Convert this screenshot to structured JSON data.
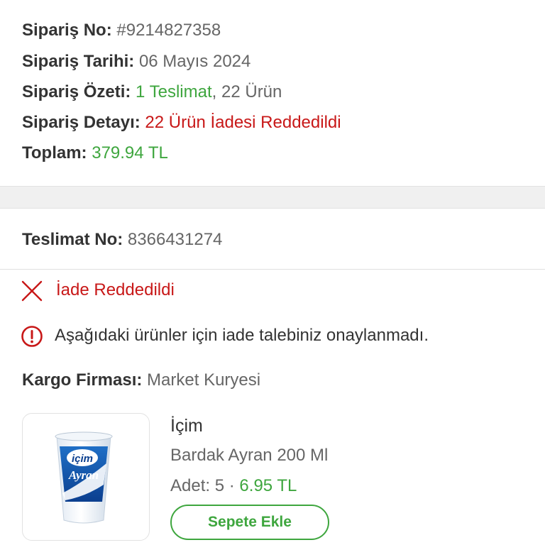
{
  "order": {
    "no_label": "Sipariş No:",
    "no_value": "#9214827358",
    "date_label": "Sipariş Tarihi:",
    "date_value": "06 Mayıs 2024",
    "summary_label": "Sipariş Özeti:",
    "summary_delivery": "1 Teslimat",
    "summary_sep": ",",
    "summary_items": " 22 Ürün",
    "detail_label": "Sipariş Detayı:",
    "detail_value": "22 Ürün İadesi Reddedildi",
    "total_label": "Toplam:",
    "total_value": "379.94 TL"
  },
  "delivery": {
    "no_label": "Teslimat No:",
    "no_value": "8366431274",
    "status": "İade Reddedildi",
    "warning": "Aşağıdaki ürünler için iade talebiniz onaylanmadı.",
    "cargo_label": "Kargo Firması:",
    "cargo_value": "Market Kuryesi"
  },
  "product": {
    "brand": "İçim",
    "name": "Bardak Ayran 200 Ml",
    "qty_label": "Adet:",
    "qty_value": "5",
    "dot": "·",
    "price": "6.95 TL",
    "add_button": "Sepete Ekle",
    "image_logo": "içim",
    "image_script": "Ayran"
  },
  "colors": {
    "green": "#3ea63e",
    "red": "#c81818",
    "grey_text": "#666666",
    "label_text": "#333333"
  },
  "icons": {
    "status": "close-x-icon",
    "warning": "info-circle-icon"
  }
}
